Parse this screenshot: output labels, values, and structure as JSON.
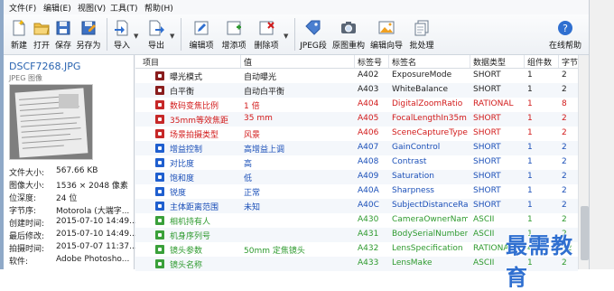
{
  "menu": [
    "文件(F)",
    "编辑(E)",
    "视图(V)",
    "工具(T)",
    "帮助(H)"
  ],
  "toolbar": {
    "new": "新建",
    "open": "打开",
    "save": "保存",
    "save_as": "另存为",
    "import": "导入",
    "export": "导出",
    "edit_item": "编辑项",
    "add_item": "增添项",
    "delete_item": "删除项",
    "jpeg_segment": "JPEG段",
    "image_rebuild": "原图重构",
    "edit_wizard": "编辑向导",
    "batch": "批处理",
    "online_help": "在线帮助"
  },
  "file": {
    "name": "DSCF7268.JPG",
    "type": "JPEG 图像",
    "props": [
      {
        "k": "文件大小:",
        "v": "567.66 KB"
      },
      {
        "k": "图像大小:",
        "v": "1536 × 2048 像素"
      },
      {
        "k": "位深度:",
        "v": "24 位"
      },
      {
        "k": "字节序:",
        "v": "Motorola (大端字..."
      },
      {
        "k": "创建时间:",
        "v": "2015-07-10 14:49..."
      },
      {
        "k": "最后修改:",
        "v": "2015-07-10 14:49..."
      },
      {
        "k": "拍摄时间:",
        "v": "2015-07-07 11:37..."
      },
      {
        "k": "软件:",
        "v": "Adobe Photosho..."
      }
    ]
  },
  "columns": [
    "项目",
    "值",
    "标签号",
    "标签名",
    "数据类型",
    "组件数",
    "字节"
  ],
  "rows": [
    {
      "name": "曝光模式",
      "value": "自动曝光",
      "tag": "A402",
      "tagname": "ExposureMode",
      "type": "SHORT",
      "count": "1",
      "bytes": "2",
      "color": "#1f1f1f",
      "icon": "#8a1d1d"
    },
    {
      "name": "白平衡",
      "value": "自动白平衡",
      "tag": "A403",
      "tagname": "WhiteBalance",
      "type": "SHORT",
      "count": "1",
      "bytes": "2",
      "color": "#1f1f1f",
      "icon": "#8a1d1d"
    },
    {
      "name": "数码变焦比例",
      "value": "1 倍",
      "tag": "A404",
      "tagname": "DigitalZoomRatio",
      "type": "RATIONAL",
      "count": "1",
      "bytes": "8",
      "color": "#d21a1a",
      "icon": "#c62828"
    },
    {
      "name": "35mm等效焦距",
      "value": "35 mm",
      "tag": "A405",
      "tagname": "FocalLengthIn35m...",
      "type": "SHORT",
      "count": "1",
      "bytes": "2",
      "color": "#d21a1a",
      "icon": "#c62828"
    },
    {
      "name": "场景拍摄类型",
      "value": "风景",
      "tag": "A406",
      "tagname": "SceneCaptureType",
      "type": "SHORT",
      "count": "1",
      "bytes": "2",
      "color": "#d21a1a",
      "icon": "#c62828"
    },
    {
      "name": "增益控制",
      "value": "高增益上调",
      "tag": "A407",
      "tagname": "GainControl",
      "type": "SHORT",
      "count": "1",
      "bytes": "2",
      "color": "#1a4fb8",
      "icon": "#1f5fcf"
    },
    {
      "name": "对比度",
      "value": "高",
      "tag": "A408",
      "tagname": "Contrast",
      "type": "SHORT",
      "count": "1",
      "bytes": "2",
      "color": "#1a4fb8",
      "icon": "#1f5fcf"
    },
    {
      "name": "饱和度",
      "value": "低",
      "tag": "A409",
      "tagname": "Saturation",
      "type": "SHORT",
      "count": "1",
      "bytes": "2",
      "color": "#1a4fb8",
      "icon": "#1f5fcf"
    },
    {
      "name": "锐度",
      "value": "正常",
      "tag": "A40A",
      "tagname": "Sharpness",
      "type": "SHORT",
      "count": "1",
      "bytes": "2",
      "color": "#1a4fb8",
      "icon": "#1f5fcf"
    },
    {
      "name": "主体距离范围",
      "value": "未知",
      "tag": "A40C",
      "tagname": "SubjectDistanceRa...",
      "type": "SHORT",
      "count": "1",
      "bytes": "2",
      "color": "#1a4fb8",
      "icon": "#1f5fcf"
    },
    {
      "name": "相机持有人",
      "value": "",
      "tag": "A430",
      "tagname": "CameraOwnerName",
      "type": "ASCII",
      "count": "1",
      "bytes": "2",
      "color": "#2e9a2e",
      "icon": "#3aa03a"
    },
    {
      "name": "机身序列号",
      "value": "",
      "tag": "A431",
      "tagname": "BodySerialNumber",
      "type": "ASCII",
      "count": "1",
      "bytes": "2",
      "color": "#2e9a2e",
      "icon": "#3aa03a"
    },
    {
      "name": "镜头参数",
      "value": "50mm 定焦镜头",
      "tag": "A432",
      "tagname": "LensSpecification",
      "type": "RATIONAL",
      "count": "4",
      "bytes": "32",
      "color": "#2e9a2e",
      "icon": "#3aa03a"
    },
    {
      "name": "镜头名称",
      "value": "",
      "tag": "A433",
      "tagname": "LensMake",
      "type": "ASCII",
      "count": "1",
      "bytes": "2",
      "color": "#2e9a2e",
      "icon": "#3aa03a"
    }
  ],
  "watermark": "最需教育"
}
